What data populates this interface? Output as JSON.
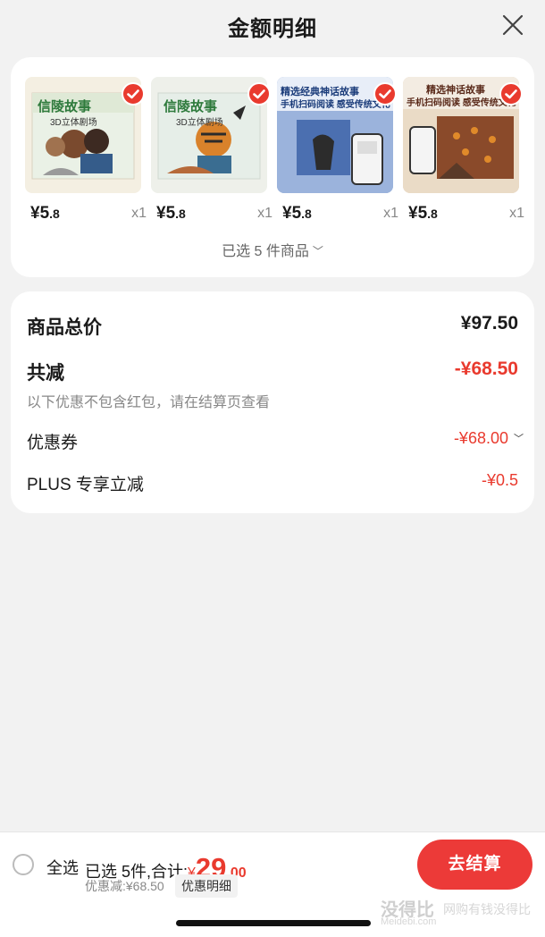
{
  "header": {
    "title": "金额明细",
    "close_icon": "close-icon"
  },
  "products": [
    {
      "price_int": "¥5",
      "price_dec": ".8",
      "qty": "x1",
      "accent": "#f4efe2",
      "text": "信陵故事",
      "sub": "3D立体剧场"
    },
    {
      "price_int": "¥5",
      "price_dec": ".8",
      "qty": "x1",
      "accent": "#eef0ea",
      "text": "信陵故事",
      "sub": "3D立体剧场"
    },
    {
      "price_int": "¥5",
      "price_dec": ".8",
      "qty": "x1",
      "accent": "#6f8fc6",
      "text": "精选经典神话故事",
      "sub": "手机扫码阅读  感受传统文化"
    },
    {
      "price_int": "¥5",
      "price_dec": ".8",
      "qty": "x1",
      "accent": "#e8d6c2",
      "text": "精选神话故事",
      "sub": "手机扫码阅读  感受传统文化"
    }
  ],
  "selected_summary": "已选 5 件商品",
  "summary": {
    "total_label": "商品总价",
    "total_value": "¥97.50",
    "reduce_label": "共减",
    "reduce_value": "-¥68.50",
    "note": "以下优惠不包含红包，请在结算页查看",
    "coupon_label": "优惠券",
    "coupon_value": "-¥68.00",
    "plus_label": "PLUS 专享立减",
    "plus_value": "-¥0.5"
  },
  "bottom": {
    "select_all": "全选",
    "selected_text": "已选 5件,合计:",
    "currency": "¥",
    "amount_int": "29",
    "amount_dec": ".00",
    "discount": "优惠减:¥68.50",
    "detail_tag": "优惠明细",
    "checkout": "去结算",
    "watermark": "没得比",
    "watermark_sub": "Meidebi.com",
    "watermark_right": "网购有钱没得比"
  },
  "colors": {
    "accent_red": "#e93a2e",
    "checkout_red": "#ec3a38"
  }
}
